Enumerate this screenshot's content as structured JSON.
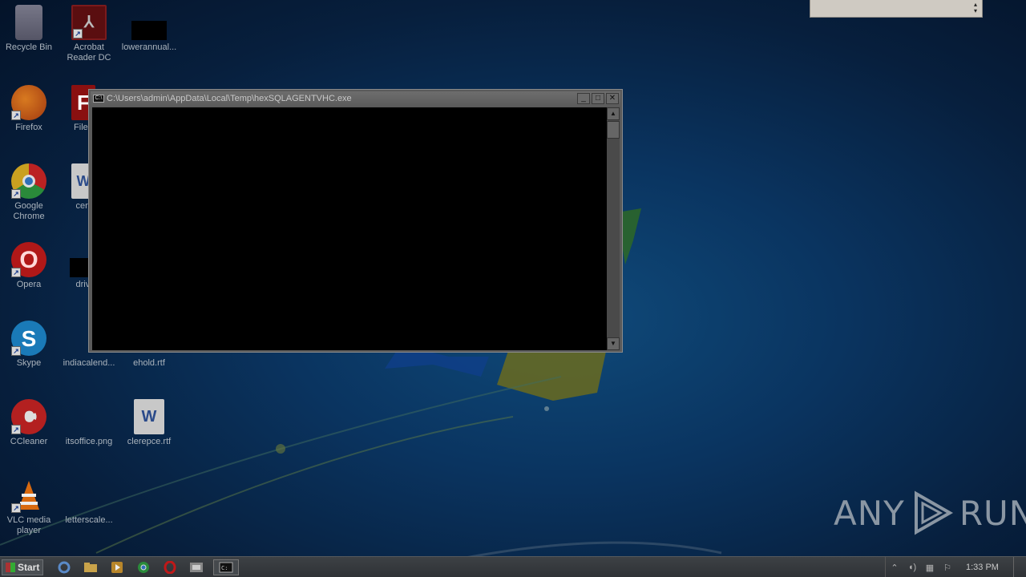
{
  "desktop": {
    "icons": [
      {
        "label": "Recycle Bin",
        "icon": "recycle-bin-icon"
      },
      {
        "label": "Acrobat Reader DC",
        "icon": "acrobat-icon"
      },
      {
        "label": "lowerannual...",
        "icon": "file-icon"
      },
      {
        "label": "Firefox",
        "icon": "firefox-icon"
      },
      {
        "label": "FileZilla",
        "icon": "filezilla-icon"
      },
      {
        "label": "Google Chrome",
        "icon": "chrome-icon"
      },
      {
        "label": "certain",
        "icon": "word-doc-icon"
      },
      {
        "label": "Opera",
        "icon": "opera-icon"
      },
      {
        "label": "drivers",
        "icon": "file-icon"
      },
      {
        "label": "Skype",
        "icon": "skype-icon"
      },
      {
        "label": "indiacalend...",
        "icon": "file-icon"
      },
      {
        "label": "ehold.rtf",
        "icon": "rtf-icon"
      },
      {
        "label": "CCleaner",
        "icon": "ccleaner-icon"
      },
      {
        "label": "itsoffice.png",
        "icon": "image-icon"
      },
      {
        "label": "clerepce.rtf",
        "icon": "word-doc-icon"
      },
      {
        "label": "VLC media player",
        "icon": "vlc-icon"
      },
      {
        "label": "letterscale...",
        "icon": "file-icon"
      }
    ]
  },
  "console": {
    "title": "C:\\Users\\admin\\AppData\\Local\\Temp\\hexSQLAGENTVHC.exe",
    "minimize": "_",
    "maximize": "□",
    "close": "✕",
    "icon_text": "C:\\"
  },
  "watermark": {
    "left": "ANY",
    "right": "RUN"
  },
  "taskbar": {
    "start_label": "Start",
    "items": [
      "ie-icon",
      "explorer-icon",
      "media-player-icon",
      "chrome-icon",
      "opera-icon",
      "app-icon",
      "console-icon"
    ],
    "clock": "1:33 PM"
  },
  "colors": {
    "desktop": "#0a3460",
    "console_bg": "#000000",
    "taskbar": "#2f3236"
  }
}
